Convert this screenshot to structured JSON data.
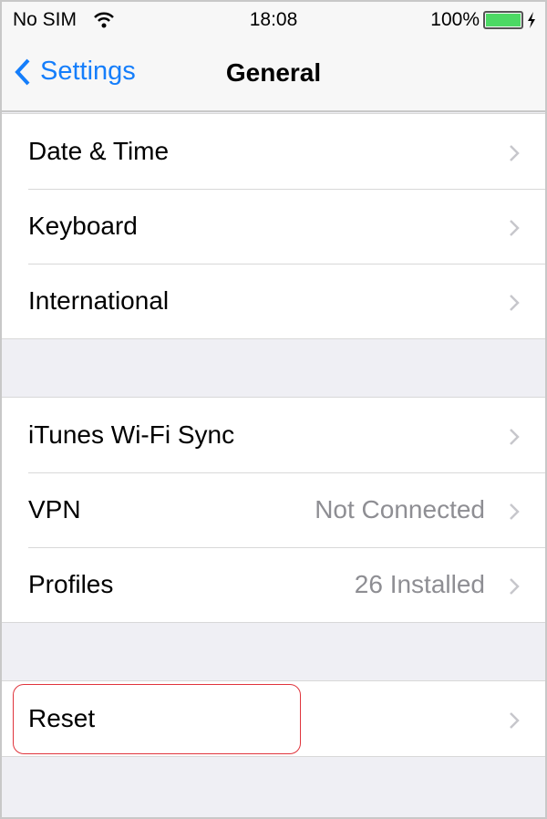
{
  "status_bar": {
    "carrier": "No SIM",
    "time": "18:08",
    "battery": "100%",
    "battery_level": 1.0,
    "battery_color": "#4cd964"
  },
  "nav": {
    "back_label": "Settings",
    "title": "General",
    "accent": "#157efb"
  },
  "groups": [
    [
      {
        "label": "Date & Time"
      },
      {
        "label": "Keyboard"
      },
      {
        "label": "International"
      }
    ],
    [
      {
        "label": "iTunes Wi-Fi Sync"
      },
      {
        "label": "VPN",
        "value": "Not Connected"
      },
      {
        "label": "Profiles",
        "value": "26 Installed"
      }
    ],
    [
      {
        "label": "Reset",
        "highlighted": true
      }
    ]
  ]
}
